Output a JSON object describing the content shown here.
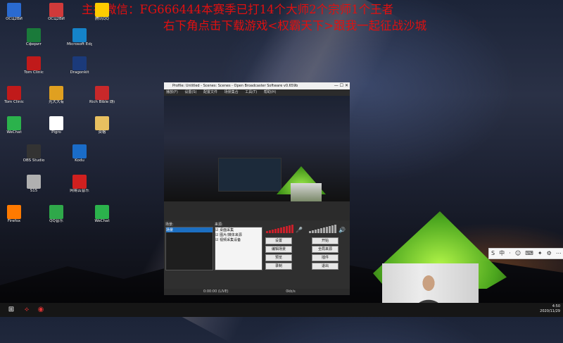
{
  "banner": {
    "line1": "主播微信：FG666444本赛季已打14个大师2个宗师1个王者",
    "line2": "右下角点击下载游戏<权霸天下>跟我一起征战沙城"
  },
  "desktop_icons": [
    {
      "label": "ОСЦ2ВЙ",
      "color": "#2a6ad0"
    },
    {
      "label": "Сферит",
      "color": "#1a7a3a"
    },
    {
      "label": "ОСЦ2ВЙ",
      "color": "#d03a3a"
    },
    {
      "label": "Microsoft Edge",
      "color": "#1583c9"
    },
    {
      "label": "腾讯QQ",
      "color": "#ffcc00"
    },
    {
      "label": "Tom Clinic",
      "color": "#c01a1a"
    },
    {
      "label": "Tom Clinic",
      "color": "#c01a1a"
    },
    {
      "label": "光大大有",
      "color": "#e0a020"
    },
    {
      "label": "Dragonkit",
      "color": "#1b3a7a"
    },
    {
      "label": "Rich Bible 朗读器",
      "color": "#c8282a"
    },
    {
      "label": "WeChat",
      "color": "#2bb24c"
    },
    {
      "label": "OBS Studio",
      "color": "#333333"
    },
    {
      "label": "Pigro",
      "color": "#ffffff"
    },
    {
      "label": "Kodu",
      "color": "#1a6cc8"
    },
    {
      "label": "资格",
      "color": "#e8c060"
    },
    {
      "label": "Firefox",
      "color": "#ff7a00"
    },
    {
      "label": "S15",
      "color": "#b0b0b0"
    },
    {
      "label": "QQ音乐",
      "color": "#2fa84a"
    },
    {
      "label": "网易云音乐",
      "color": "#d0201f"
    },
    {
      "label": "WeChat",
      "color": "#2bb24c"
    }
  ],
  "obs": {
    "title": "Profile: Untitled - Scenes: Scenes - Open Broadcaster Software v0.659b",
    "menu": [
      "播放(F)",
      "设置(S)",
      "配置文件",
      "场景集合",
      "工具(T)",
      "帮助(H)"
    ],
    "scenes_header": "场景:",
    "scenes": [
      "场景"
    ],
    "sources_header": "来源:",
    "sources": [
      "桌面采集",
      "图片/媒体来源",
      "视频采集设备"
    ],
    "buttons": {
      "settings": "设置",
      "start_stream": "开始",
      "edit_scene": "编辑场景",
      "global_sources": "全局来源",
      "preview_stream": "预览",
      "plugins": "插件",
      "exit": "退出",
      "start_record": "录制"
    },
    "status_left": "0:00:00 (LIVE)",
    "status_right": "0kb/s"
  },
  "ime": {
    "items": [
      "S",
      "中",
      "·",
      "☺",
      "⌨",
      "✦",
      "⚙",
      "⋯"
    ]
  },
  "tray": {
    "time": "4:50",
    "date": "2020/11/29"
  }
}
